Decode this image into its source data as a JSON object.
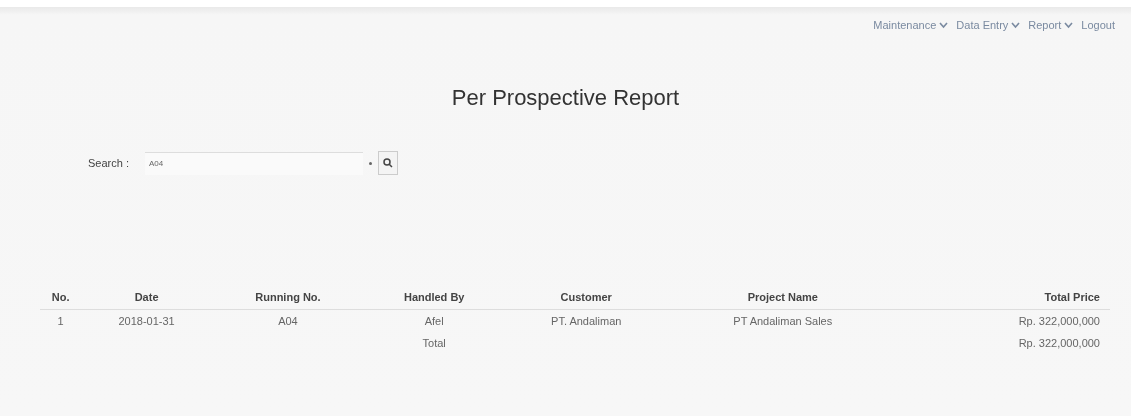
{
  "nav": [
    {
      "label": "Maintenance",
      "dropdown": true
    },
    {
      "label": "Data Entry",
      "dropdown": true
    },
    {
      "label": "Report",
      "dropdown": true
    },
    {
      "label": "Logout",
      "dropdown": false
    }
  ],
  "title": "Per Prospective Report",
  "search": {
    "label": "Search :",
    "value": "A04"
  },
  "table": {
    "columns": [
      "No.",
      "Date",
      "Running No.",
      "Handled By",
      "Customer",
      "Project Name",
      "Total Price"
    ],
    "rows": [
      [
        "1",
        "2018-01-31",
        "A04",
        "Afel",
        "PT. Andaliman",
        "PT Andaliman Sales",
        "Rp. 322,000,000"
      ]
    ],
    "total": {
      "label": "Total",
      "value": "Rp. 322,000,000"
    }
  }
}
